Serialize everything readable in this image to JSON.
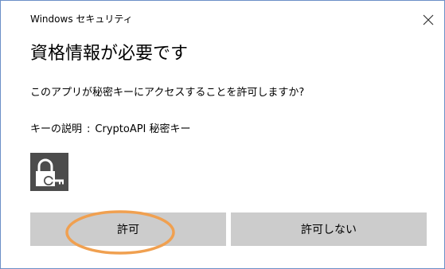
{
  "dialog": {
    "caption": "Windows セキュリティ",
    "close_icon": "close-icon",
    "title": "資格情報が必要です",
    "question": "このアプリが秘密キーにアクセスすることを許可しますか?",
    "description": {
      "label": "キーの説明",
      "separator": ":",
      "value": "CryptoAPI 秘密キー"
    },
    "key_icon": "padlock-key-icon",
    "buttons": {
      "allow_label": "許可",
      "deny_label": "許可しない"
    }
  },
  "annotation": {
    "icon": "orange-circle-highlight",
    "color": "#f0a050"
  },
  "colors": {
    "window_border": "#6b8fc7",
    "button_bg": "#cccccc",
    "icon_tile": "#4c4c4c",
    "highlight": "#f0a050"
  }
}
